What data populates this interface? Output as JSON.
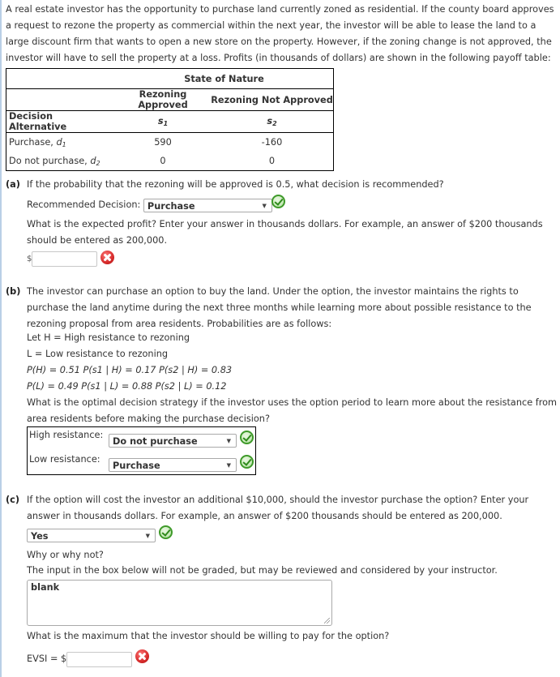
{
  "intro": "A real estate investor has the opportunity to purchase land currently zoned as residential. If the county board approves a request to rezone the property as commercial within the next year, the investor will be able to lease the land to a large discount firm that wants to open a new store on the property. However, if the zoning change is not approved, the investor will have to sell the property at a loss. Profits (in thousands of dollars) are shown in the following payoff table:",
  "table": {
    "state_header": "State of Nature",
    "col_headers": [
      "Rezoning Approved",
      "Rezoning Not Approved"
    ],
    "row_header": "Decision Alternative",
    "state_symbols": [
      {
        "base": "s",
        "sub": "1"
      },
      {
        "base": "s",
        "sub": "2"
      }
    ],
    "rows": [
      {
        "label": "Purchase, ",
        "var": "d",
        "sub": "1",
        "values": [
          "590",
          "-160"
        ]
      },
      {
        "label": "Do not purchase, ",
        "var": "d",
        "sub": "2",
        "values": [
          "0",
          "0"
        ]
      }
    ]
  },
  "part_a": {
    "label": "(a)",
    "question": "If the probability that the rezoning will be approved is 0.5, what decision is recommended?",
    "decision_label": "Recommended Decision:",
    "decision_value": "Purchase",
    "decision_status": "correct",
    "profit_question": "What is the expected profit? Enter your answer in thousands dollars. For example, an answer of $200 thousands should be entered as 200,000.",
    "currency": "$",
    "profit_value": "",
    "profit_status": "incorrect"
  },
  "part_b": {
    "label": "(b)",
    "text": "The investor can purchase an option to buy the land. Under the option, the investor maintains the rights to purchase the land anytime during the next three months while learning more about possible resistance to the rezoning proposal from area residents. Probabilities are as follows:",
    "let_h": "Let H = High resistance to rezoning",
    "let_l": "L = Low resistance to rezoning",
    "prob_h": "P(H) = 0.51  P(s1 | H) = 0.17  P(s2 | H) = 0.83",
    "prob_l": "P(L) = 0.49  P(s1 | L) = 0.88  P(s2 | L) = 0.12",
    "question": "What is the optimal decision strategy if the investor uses the option period to learn more about the resistance from area residents before making the purchase decision?",
    "high_label": "High resistance:",
    "high_value": "Do not purchase",
    "high_status": "correct",
    "low_label": "Low resistance:",
    "low_value": "Purchase",
    "low_status": "correct"
  },
  "part_c": {
    "label": "(c)",
    "question": "If the option will cost the investor an additional $10,000, should the investor purchase the option? Enter your answer in thousands dollars. For example, an answer of $200 thousands should be entered as 200,000.",
    "answer_value": "Yes",
    "answer_status": "correct",
    "why": "Why or why not?",
    "note": "The input in the box below will not be graded, but may be reviewed and considered by your instructor.",
    "textarea_value": "blank",
    "max_question": "What is the maximum that the investor should be willing to pay for the option?",
    "evsi_label": "EVSI = $",
    "evsi_value": "",
    "evsi_status": "incorrect"
  }
}
